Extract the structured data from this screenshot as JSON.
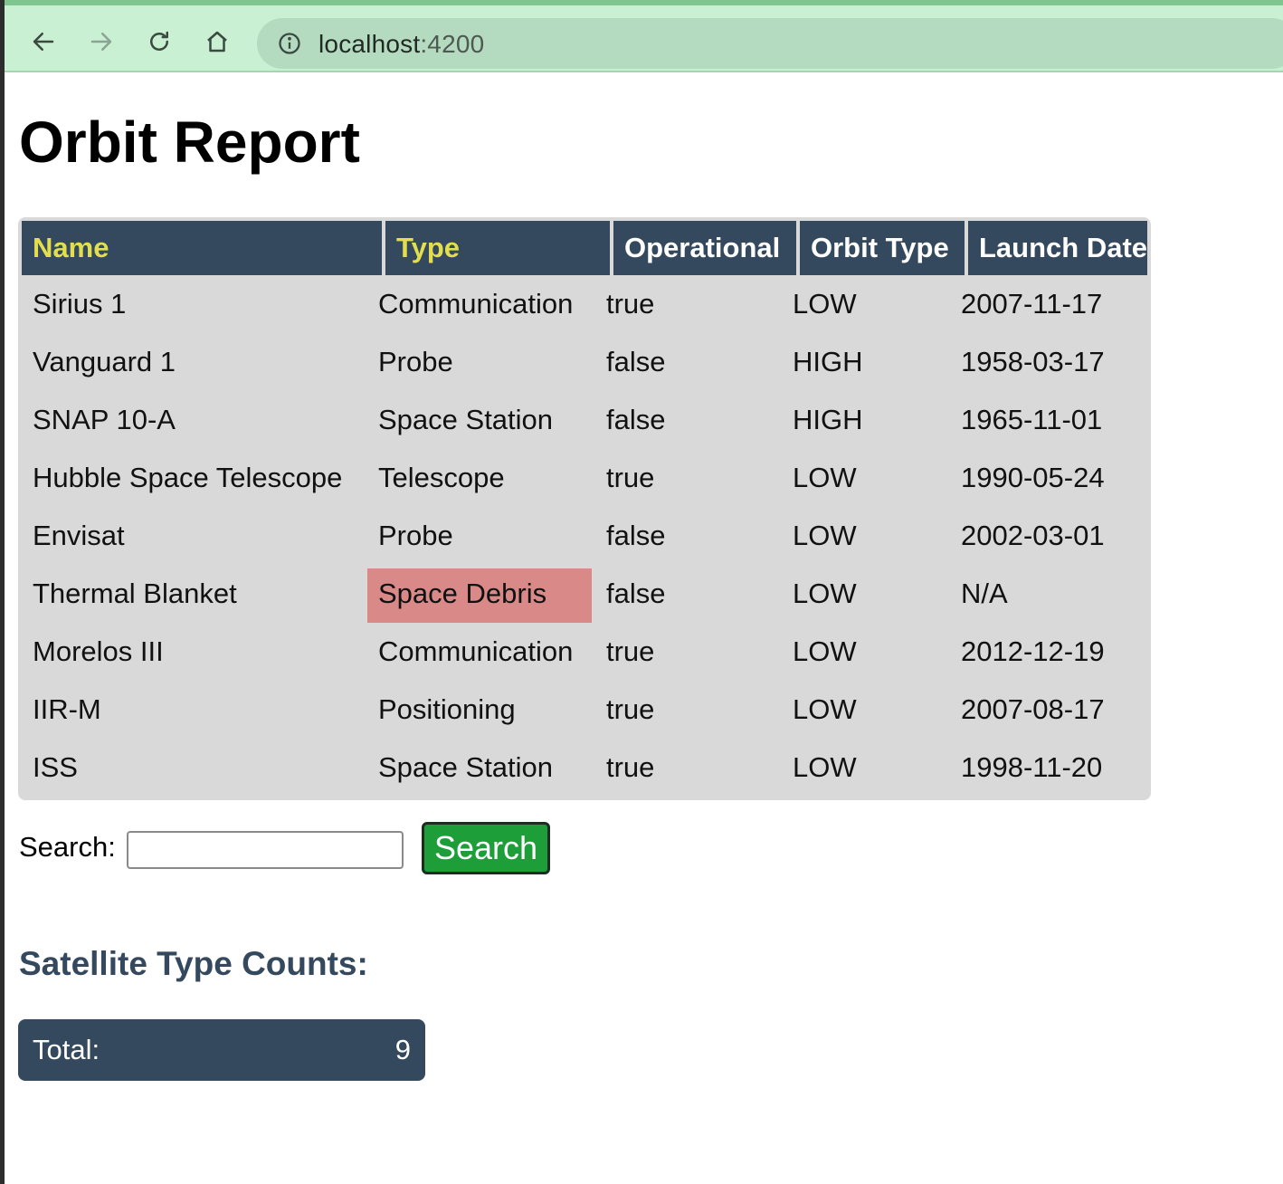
{
  "browser": {
    "url_host": "localhost",
    "url_port": ":4200",
    "icons": [
      "back-arrow-icon",
      "forward-arrow-icon",
      "reload-icon",
      "home-icon",
      "info-icon"
    ]
  },
  "page": {
    "title": "Orbit Report"
  },
  "table": {
    "headers": [
      "Name",
      "Type",
      "Operational",
      "Orbit Type",
      "Launch Date"
    ],
    "rows": [
      {
        "name": "Sirius 1",
        "type": "Communication",
        "operational": "true",
        "orbit": "LOW",
        "launch": "2007-11-17"
      },
      {
        "name": "Vanguard 1",
        "type": "Probe",
        "operational": "false",
        "orbit": "HIGH",
        "launch": "1958-03-17"
      },
      {
        "name": "SNAP 10-A",
        "type": "Space Station",
        "operational": "false",
        "orbit": "HIGH",
        "launch": "1965-11-01"
      },
      {
        "name": "Hubble Space Telescope",
        "type": "Telescope",
        "operational": "true",
        "orbit": "LOW",
        "launch": "1990-05-24"
      },
      {
        "name": "Envisat",
        "type": "Probe",
        "operational": "false",
        "orbit": "LOW",
        "launch": "2002-03-01"
      },
      {
        "name": "Thermal Blanket",
        "type": "Space Debris",
        "operational": "false",
        "orbit": "LOW",
        "launch": "N/A"
      },
      {
        "name": "Morelos III",
        "type": "Communication",
        "operational": "true",
        "orbit": "LOW",
        "launch": "2012-12-19"
      },
      {
        "name": "IIR-M",
        "type": "Positioning",
        "operational": "true",
        "orbit": "LOW",
        "launch": "2007-08-17"
      },
      {
        "name": "ISS",
        "type": "Space Station",
        "operational": "true",
        "orbit": "LOW",
        "launch": "1998-11-20"
      }
    ]
  },
  "search": {
    "label": "Search:",
    "value": "",
    "button_label": "Search"
  },
  "counts": {
    "heading": "Satellite Type Counts:",
    "total_label": "Total:",
    "total_value": "9"
  },
  "colors": {
    "header_bg": "#34495e",
    "header_accent": "#e2de4e",
    "table_bg": "#dad9da",
    "debris_highlight": "#d98a88",
    "search_button": "#1e9e39",
    "browser_bar": "#c9f0d3"
  }
}
